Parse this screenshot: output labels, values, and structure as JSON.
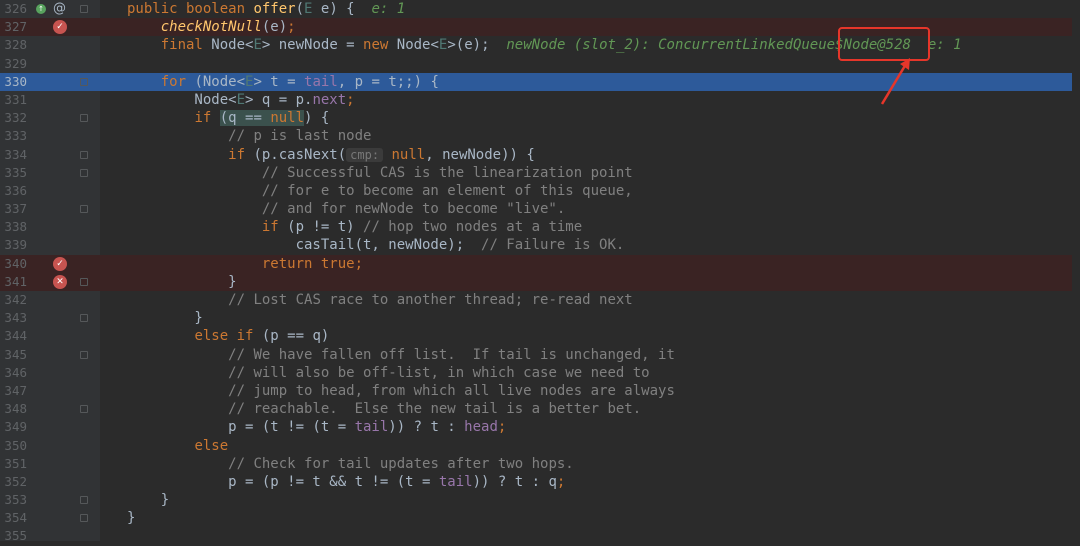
{
  "colors": {
    "background": "#2b2b2b",
    "gutter": "#313335",
    "keyword": "#cc7832",
    "method": "#ffc66d",
    "field": "#9876aa",
    "comment": "#808080",
    "debug_inline": "#629755",
    "exec_line": "#2d5a9a",
    "breakpoint_line": "#3a2323",
    "breakpoint_marker": "#c75450",
    "annotation_box": "#e6362a"
  },
  "gutter_icons": {
    "line_326_implementing": "override-icon",
    "line_326_annotation": "at-icon",
    "breakpoint": "breakpoint-icon",
    "breakpoint_disabled": "breakpoint-invalid-icon"
  },
  "lines": [
    {
      "n": "326"
    },
    {
      "n": "327"
    },
    {
      "n": "328"
    },
    {
      "n": "329"
    },
    {
      "n": "330"
    },
    {
      "n": "331"
    },
    {
      "n": "332"
    },
    {
      "n": "333"
    },
    {
      "n": "334"
    },
    {
      "n": "335"
    },
    {
      "n": "336"
    },
    {
      "n": "337"
    },
    {
      "n": "338"
    },
    {
      "n": "339"
    },
    {
      "n": "340"
    },
    {
      "n": "341"
    },
    {
      "n": "342"
    },
    {
      "n": "343"
    },
    {
      "n": "344"
    },
    {
      "n": "345"
    },
    {
      "n": "346"
    },
    {
      "n": "347"
    },
    {
      "n": "348"
    },
    {
      "n": "349"
    },
    {
      "n": "350"
    },
    {
      "n": "351"
    },
    {
      "n": "352"
    },
    {
      "n": "353"
    },
    {
      "n": "354"
    },
    {
      "n": "355"
    }
  ],
  "code": {
    "l326": {
      "a": "public boolean ",
      "fn": "offer",
      "b": "(",
      "t": "E",
      "c": " e) {  ",
      "dbg": "e: 1"
    },
    "l327": {
      "a": "    ",
      "it": "checkNotNull",
      "b": "(e)",
      ";": ";"
    },
    "l328": {
      "a": "    ",
      "kw": "final ",
      "b": "Node<",
      "t": "E",
      "c": "> newNode = ",
      "kw2": "new ",
      "d": "Node<",
      "t2": "E",
      "e": ">(e);  ",
      "dbg1": "newNode (slot_2): ConcurrentLinkedQueue",
      "dbg2": "$Node@528",
      "dbg3": "  e: 1"
    },
    "l329": {
      "a": ""
    },
    "l330": {
      "a": "    ",
      "kw": "for ",
      "b": "(Node<",
      "t": "E",
      "c": "> t = ",
      "f": "tail",
      ",": ", p = t;;) {"
    },
    "l331": {
      "a": "        Node<",
      "t": "E",
      "b": "> q = p.",
      "f": "next",
      ";": ";"
    },
    "l332": {
      "a": "        ",
      "kw": "if ",
      "b": "(q == ",
      "kw2": "null",
      "c": ") {"
    },
    "l333": {
      "a": "            ",
      "cm": "// p is last node"
    },
    "l334": {
      "a": "            ",
      "kw": "if ",
      "b": "(p.casNext(",
      "hint": "cmp:",
      "kw2": " null",
      ",": ", newNode)) {"
    },
    "l335": {
      "a": "                ",
      "cm": "// Successful CAS is the linearization point"
    },
    "l336": {
      "a": "                ",
      "cm": "// for e to become an element of this queue,"
    },
    "l337": {
      "a": "                ",
      "cm": "// and for newNode to become \"live\"."
    },
    "l338": {
      "a": "                ",
      "kw": "if ",
      "b": "(p != t) ",
      "cm": "// hop two nodes at a time"
    },
    "l339": {
      "a": "                    casTail(t, newNode);  ",
      "cm": "// Failure is OK."
    },
    "l340": {
      "a": "                ",
      "kw": "return true;"
    },
    "l341": {
      "a": "            }"
    },
    "l342": {
      "a": "            ",
      "cm": "// Lost CAS race to another thread; re-read next"
    },
    "l343": {
      "a": "        }"
    },
    "l344": {
      "a": "        ",
      "kw": "else if ",
      "b": "(p == q)"
    },
    "l345": {
      "a": "            ",
      "cm": "// We have fallen off list.  If tail is unchanged, it"
    },
    "l346": {
      "a": "            ",
      "cm": "// will also be off-list, in which case we need to"
    },
    "l347": {
      "a": "            ",
      "cm": "// jump to head, from which all live nodes are always"
    },
    "l348": {
      "a": "            ",
      "cm": "// reachable.  Else the new tail is a better bet."
    },
    "l349": {
      "a": "            p = (t != (t = ",
      "f": "tail",
      "b": ")) ? t : ",
      "f2": "head",
      ";": ";"
    },
    "l350": {
      "a": "        ",
      "kw": "else"
    },
    "l351": {
      "a": "            ",
      "cm": "// Check for tail updates after two hops."
    },
    "l352": {
      "a": "            p = (p != t && t != (t = ",
      "f": "tail",
      "b": ")) ? t : q",
      ";": ";"
    },
    "l353": {
      "a": "    }"
    },
    "l354": {
      "a": "}"
    },
    "l355": {
      "a": ""
    }
  }
}
